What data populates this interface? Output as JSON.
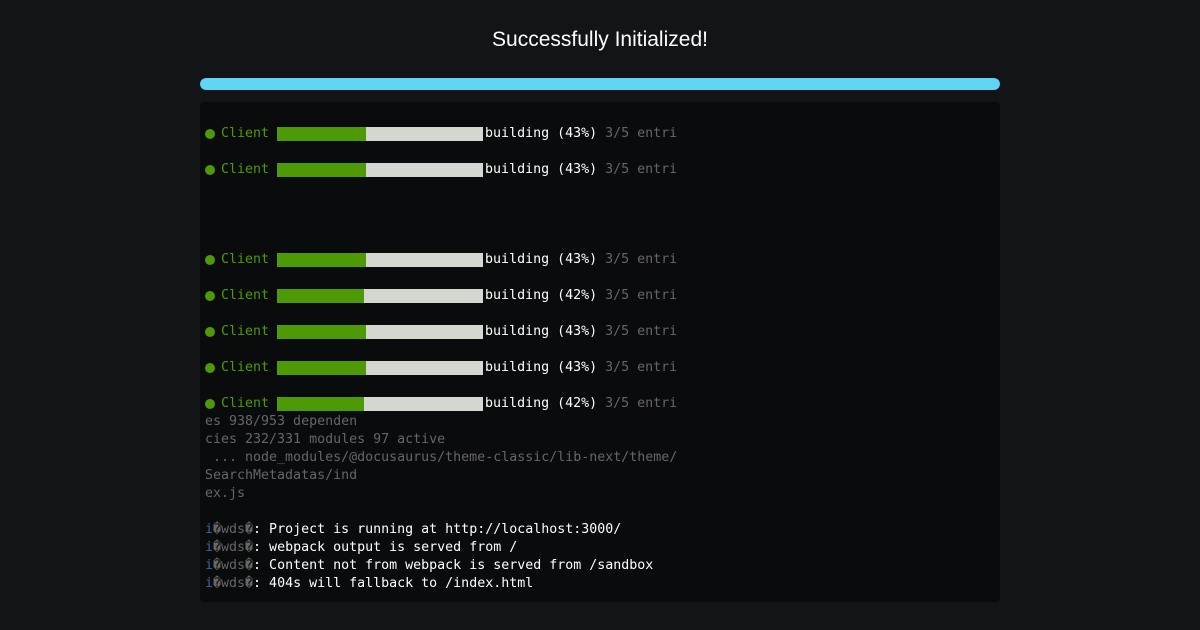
{
  "title": "Successfully Initialized!",
  "progress": {
    "percent": 100,
    "color": "#61d5f5"
  },
  "build_rows": [
    {
      "label": "Client",
      "status": "building (43%)",
      "entries": "3/5 entri",
      "fill_percent": 43
    },
    {
      "label": "Client",
      "status": "building (43%)",
      "entries": "3/5 entri",
      "fill_percent": 43
    },
    {
      "label": "Client",
      "status": "building (43%)",
      "entries": "3/5 entri",
      "fill_percent": 43
    },
    {
      "label": "Client",
      "status": "building (42%)",
      "entries": "3/5 entri",
      "fill_percent": 42
    },
    {
      "label": "Client",
      "status": "building (43%)",
      "entries": "3/5 entri",
      "fill_percent": 43
    },
    {
      "label": "Client",
      "status": "building (43%)",
      "entries": "3/5 entri",
      "fill_percent": 43
    },
    {
      "label": "Client",
      "status": "building (42%)",
      "entries": "3/5 entri",
      "fill_percent": 42
    }
  ],
  "continuation_lines": [
    "es 938/953 dependen",
    "cies 232/331 modules 97 active",
    " ... node_modules/@docusaurus/theme-classic/lib-next/theme/",
    "SearchMetadatas/ind",
    "ex.js"
  ],
  "wds_lines": [
    {
      "icon": "i",
      "tag": "�wds�",
      "text": ": Project is running at http://localhost:3000/"
    },
    {
      "icon": "i",
      "tag": "�wds�",
      "text": ": webpack output is served from /"
    },
    {
      "icon": "i",
      "tag": "�wds�",
      "text": ": Content not from webpack is served from /sandbox"
    },
    {
      "icon": "i",
      "tag": "�wds�",
      "text": ": 404s will fallback to /index.html"
    }
  ],
  "colors": {
    "background": "#131416",
    "terminal_bg": "#0a0b0d",
    "accent_green": "#4e9a06",
    "bar_empty": "#d3d7cf",
    "info_blue": "#3465a4"
  }
}
